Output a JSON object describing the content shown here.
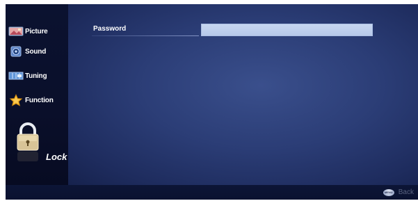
{
  "sidebar": {
    "items": [
      {
        "label": "Picture",
        "icon": "picture-icon"
      },
      {
        "label": "Sound",
        "icon": "sound-icon"
      },
      {
        "label": "Tuning",
        "icon": "tuning-icon"
      },
      {
        "label": "Function",
        "icon": "function-star-icon"
      }
    ],
    "active": {
      "label": "Lock",
      "icon": "padlock-icon"
    }
  },
  "main": {
    "password": {
      "label": "Password",
      "value": ""
    }
  },
  "footer": {
    "back": {
      "icon_text": "MENU",
      "label": "Back"
    }
  },
  "colors": {
    "panel_blue": "#2b3d76",
    "sidebar_bg": "#0b1230",
    "field_fill": "#c6d6f0",
    "star": "#f2b52b"
  }
}
